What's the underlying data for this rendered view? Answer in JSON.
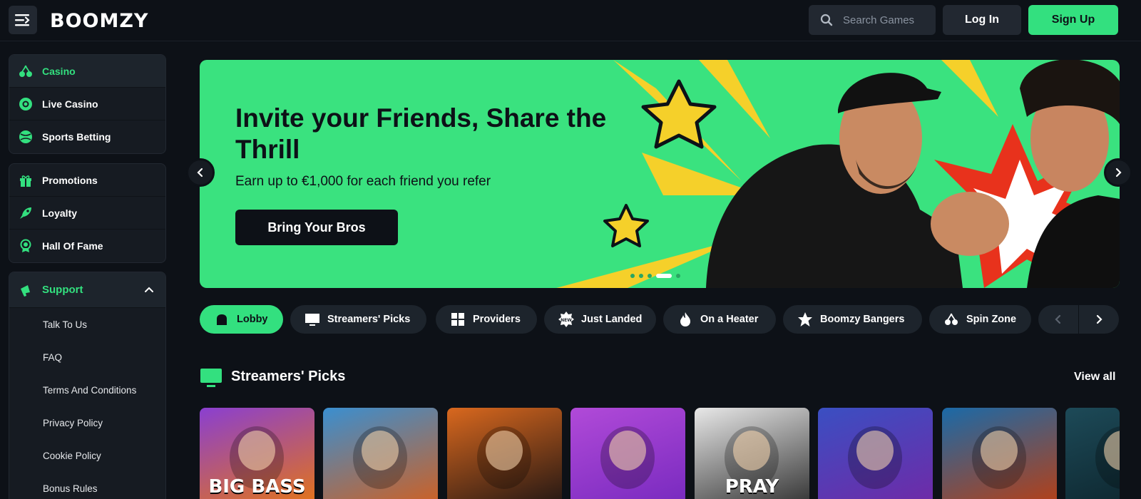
{
  "header": {
    "logo_text": "BOOMZY",
    "search_placeholder": "Search Games",
    "login_label": "Log In",
    "signup_label": "Sign Up"
  },
  "sidebar": {
    "group1": [
      {
        "label": "Casino",
        "icon": "cherries-icon",
        "active": true
      },
      {
        "label": "Live Casino",
        "icon": "chip-icon"
      },
      {
        "label": "Sports Betting",
        "icon": "ball-icon"
      }
    ],
    "group2": [
      {
        "label": "Promotions",
        "icon": "gift-icon"
      },
      {
        "label": "Loyalty",
        "icon": "rocket-icon"
      },
      {
        "label": "Hall Of Fame",
        "icon": "medal-icon"
      }
    ],
    "support": {
      "label": "Support",
      "items": [
        "Talk To Us",
        "FAQ",
        "Terms And Conditions",
        "Privacy Policy",
        "Cookie Policy",
        "Bonus Rules"
      ]
    }
  },
  "banner": {
    "title": "Invite your Friends, Share the Thrill",
    "subtitle": "Earn up to €1,000 for each friend you refer",
    "button_label": "Bring Your Bros",
    "slide_count": 5,
    "active_slide": 4
  },
  "categories": [
    {
      "label": "Lobby",
      "icon": "home-icon",
      "active": true
    },
    {
      "label": "Streamers' Picks",
      "icon": "monitor-icon"
    },
    {
      "label": "Providers",
      "icon": "grid-icon"
    },
    {
      "label": "Just Landed",
      "icon": "new-badge-icon"
    },
    {
      "label": "On a Heater",
      "icon": "fire-icon"
    },
    {
      "label": "Boomzy Bangers",
      "icon": "star-icon"
    },
    {
      "label": "Spin Zone",
      "icon": "cherries-icon"
    }
  ],
  "section": {
    "title": "Streamers' Picks",
    "view_all": "View all"
  },
  "games": [
    {
      "text": "BIG BASS",
      "colors": [
        "#8a3fd1",
        "#e0721f"
      ]
    },
    {
      "text": "",
      "colors": [
        "#3a8fd0",
        "#c9622a"
      ]
    },
    {
      "text": "",
      "colors": [
        "#d9681e",
        "#2a1a14"
      ]
    },
    {
      "text": "",
      "colors": [
        "#b14ad8",
        "#7a2bc0"
      ]
    },
    {
      "text": "PRAY",
      "colors": [
        "#e8e8e8",
        "#3b3b3b"
      ]
    },
    {
      "text": "",
      "colors": [
        "#3a4fc2",
        "#6e2ba8"
      ]
    },
    {
      "text": "",
      "colors": [
        "#1a6aa8",
        "#b0411c"
      ]
    },
    {
      "text": "",
      "colors": [
        "#1d4a58",
        "#0f2a33"
      ]
    }
  ],
  "colors": {
    "accent": "#33e07f",
    "background": "#0d1117",
    "panel": "#161b22",
    "banner": "#3ae27f"
  }
}
